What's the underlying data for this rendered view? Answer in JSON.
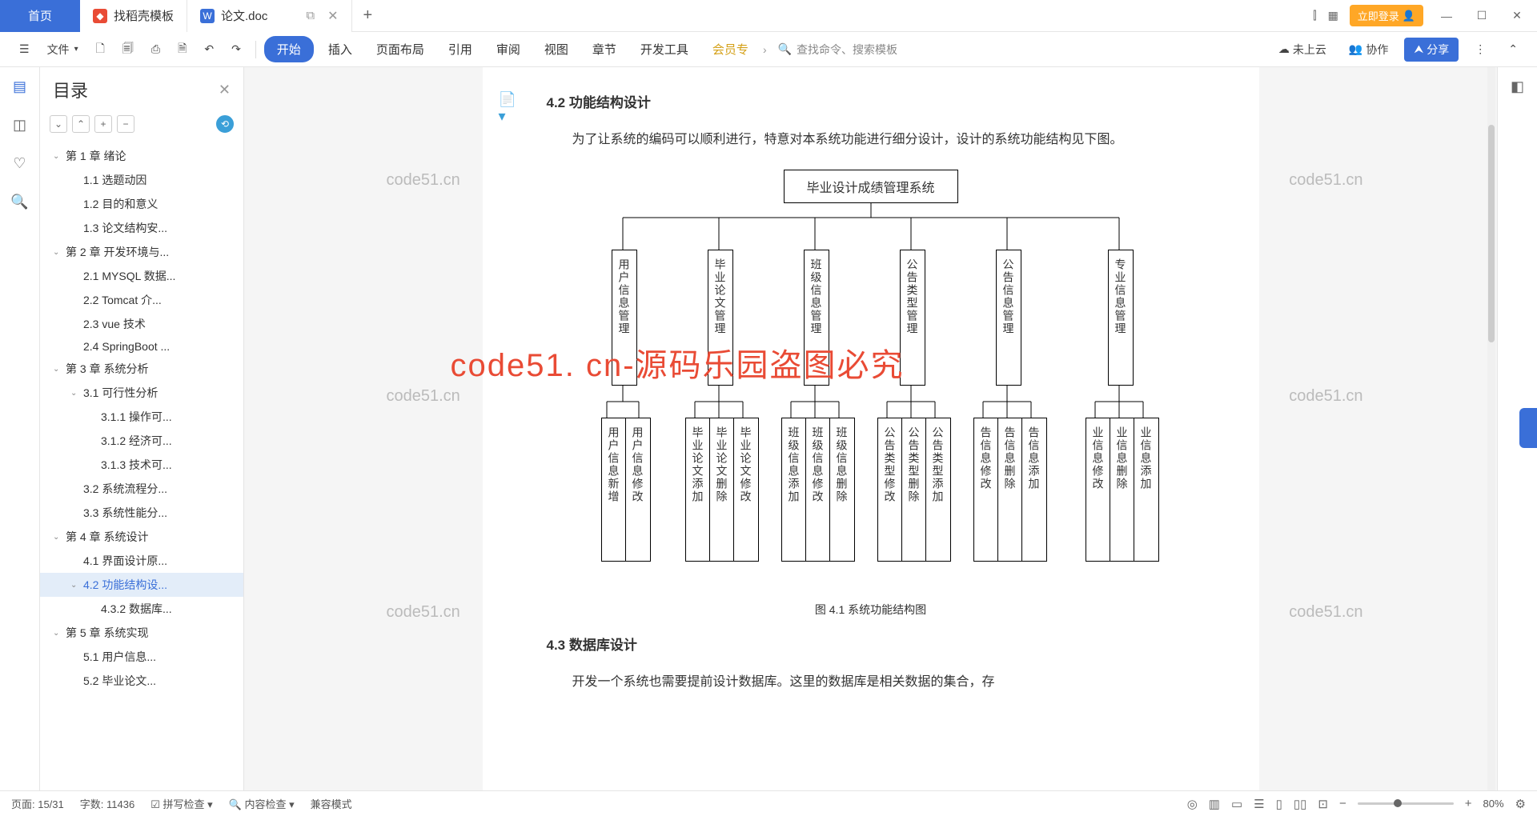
{
  "tabs": {
    "home": "首页",
    "t1": "找稻壳模板",
    "t2": "论文.doc",
    "add": "+"
  },
  "titlebar": {
    "login": "立即登录",
    "grid_icon": "▦",
    "win_min": "—",
    "win_max": "☐",
    "win_close": "✕",
    "split_icon": "⫿"
  },
  "toolbar": {
    "menu_icon": "☰",
    "file": "文件",
    "icons": [
      "🗋",
      "🗐",
      "⎙",
      "🗎",
      "↶",
      "↷"
    ],
    "menus": {
      "start": "开始",
      "insert": "插入",
      "layout": "页面布局",
      "ref": "引用",
      "review": "审阅",
      "view": "视图",
      "chapter": "章节",
      "dev": "开发工具",
      "vip": "会员专"
    },
    "search_placeholder": "查找命令、搜索模板",
    "cloud": "未上云",
    "collab": "协作",
    "share": "分享",
    "more": "⋮",
    "chev": "⌃"
  },
  "outline": {
    "title": "目录",
    "close": "✕",
    "tools": [
      "⌄",
      "⌃",
      "+",
      "−"
    ],
    "items": [
      {
        "lvl": 1,
        "chev": "⌄",
        "t": "第 1 章  绪论"
      },
      {
        "lvl": 2,
        "t": "1.1 选题动因"
      },
      {
        "lvl": 2,
        "t": "1.2 目的和意义"
      },
      {
        "lvl": 2,
        "t": "1.3 论文结构安..."
      },
      {
        "lvl": 1,
        "chev": "⌄",
        "t": "第 2 章  开发环境与..."
      },
      {
        "lvl": 2,
        "t": "2.1 MYSQL 数据..."
      },
      {
        "lvl": 2,
        "t": "2.2 Tomcat  介..."
      },
      {
        "lvl": 2,
        "t": "2.3 vue 技术"
      },
      {
        "lvl": 2,
        "t": "2.4 SpringBoot ..."
      },
      {
        "lvl": 1,
        "chev": "⌄",
        "t": "第 3 章  系统分析"
      },
      {
        "lvl": 2,
        "chev": "⌄",
        "t": "3.1 可行性分析"
      },
      {
        "lvl": 3,
        "t": "3.1.1 操作可..."
      },
      {
        "lvl": 3,
        "t": "3.1.2 经济可..."
      },
      {
        "lvl": 3,
        "t": "3.1.3 技术可..."
      },
      {
        "lvl": 2,
        "t": "3.2 系统流程分..."
      },
      {
        "lvl": 2,
        "t": "3.3 系统性能分..."
      },
      {
        "lvl": 1,
        "chev": "⌄",
        "t": "第 4 章  系统设计"
      },
      {
        "lvl": 2,
        "t": "4.1 界面设计原..."
      },
      {
        "lvl": 2,
        "chev": "⌄",
        "t": "4.2 功能结构设...",
        "active": true
      },
      {
        "lvl": 3,
        "t": "4.3.2  数据库..."
      },
      {
        "lvl": 1,
        "chev": "⌄",
        "t": "第 5 章  系统实现"
      },
      {
        "lvl": 2,
        "t": "5.1 用户信息..."
      },
      {
        "lvl": 2,
        "t": "5.2 毕业论文..."
      }
    ]
  },
  "doc": {
    "h1": "4.2 功能结构设计",
    "p1": "为了让系统的编码可以顺利进行，特意对本系统功能进行细分设计，设计的系统功能结构见下图。",
    "root": "毕业设计成绩管理系统",
    "l2": [
      "用户信息管理",
      "毕业论文管理",
      "班级信息管理",
      "公告类型管理",
      "公告信息管理",
      "专业信息管理"
    ],
    "l3": [
      [
        "用户信息新增",
        "用户信息修改"
      ],
      [
        "毕业论文添加",
        "毕业论文删除",
        "毕业论文修改"
      ],
      [
        "班级信息添加",
        "班级信息修改",
        "班级信息删除"
      ],
      [
        "公告类型修改",
        "公告类型删除",
        "公告类型添加"
      ],
      [
        "告信息修改",
        "告信息删除",
        "告信息添加"
      ],
      [
        "业信息修改",
        "业信息删除",
        "业信息添加"
      ]
    ],
    "caption": "图 4.1  系统功能结构图",
    "h2": "4.3  数据库设计",
    "p2": "开发一个系统也需要提前设计数据库。这里的数据库是相关数据的集合，存",
    "wm": "code51.cn",
    "wm_red": "code51. cn-源码乐园盗图必究"
  },
  "status": {
    "page": "页面: 15/31",
    "words": "字数: 11436",
    "spell": "拼写检查",
    "content": "内容检查",
    "compat": "兼容模式",
    "zoom": "80%"
  },
  "chart_data": {
    "type": "tree",
    "title": "系统功能结构图",
    "root": "毕业设计成绩管理系统",
    "children": [
      {
        "name": "用户信息管理",
        "children": [
          "用户信息新增",
          "用户信息修改"
        ]
      },
      {
        "name": "毕业论文管理",
        "children": [
          "毕业论文添加",
          "毕业论文删除",
          "毕业论文修改"
        ]
      },
      {
        "name": "班级信息管理",
        "children": [
          "班级信息添加",
          "班级信息修改",
          "班级信息删除"
        ]
      },
      {
        "name": "公告类型管理",
        "children": [
          "公告类型修改",
          "公告类型删除",
          "公告类型添加"
        ]
      },
      {
        "name": "公告信息管理",
        "children": [
          "公告信息修改",
          "公告信息删除",
          "公告信息添加"
        ]
      },
      {
        "name": "专业信息管理",
        "children": [
          "专业信息修改",
          "专业信息删除",
          "专业信息添加"
        ]
      }
    ]
  }
}
